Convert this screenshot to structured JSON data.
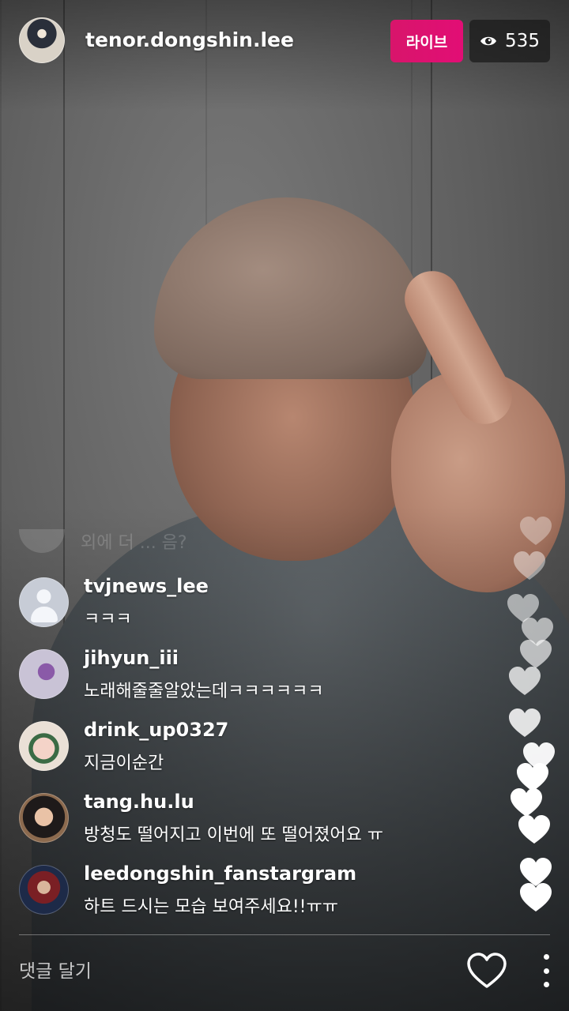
{
  "header": {
    "username": "tenor.dongshin.lee",
    "live_label": "라이브",
    "viewer_count": "535"
  },
  "faded_comment": {
    "text": "외에 더 ... 음?"
  },
  "comments": [
    {
      "username": "tvjnews_lee",
      "text": "ㅋㅋㅋ",
      "avatar": "default-avatar"
    },
    {
      "username": "jihyun_iii",
      "text": "노래해줄줄알았는데ㅋㅋㅋㅋㅋㅋ",
      "avatar": "flower-avatar"
    },
    {
      "username": "drink_up0327",
      "text": "지금이순간",
      "avatar": "drink-avatar"
    },
    {
      "username": "tang.hu.lu",
      "text": "방청도 떨어지고 이번에 또 떨어졌어요 ㅠ",
      "avatar": "girl-avatar"
    },
    {
      "username": "leedongshin_fanstargram",
      "text": "하트 드시는 모습 보여주세요!!ㅠㅠ",
      "avatar": "stage-avatar"
    }
  ],
  "footer": {
    "comment_placeholder": "댓글 달기"
  },
  "icons": {
    "eye": "eye-icon",
    "heart": "heart-icon",
    "more": "more-dots-icon"
  },
  "colors": {
    "live_badge": "#e20e75",
    "viewer_badge": "#191919"
  }
}
